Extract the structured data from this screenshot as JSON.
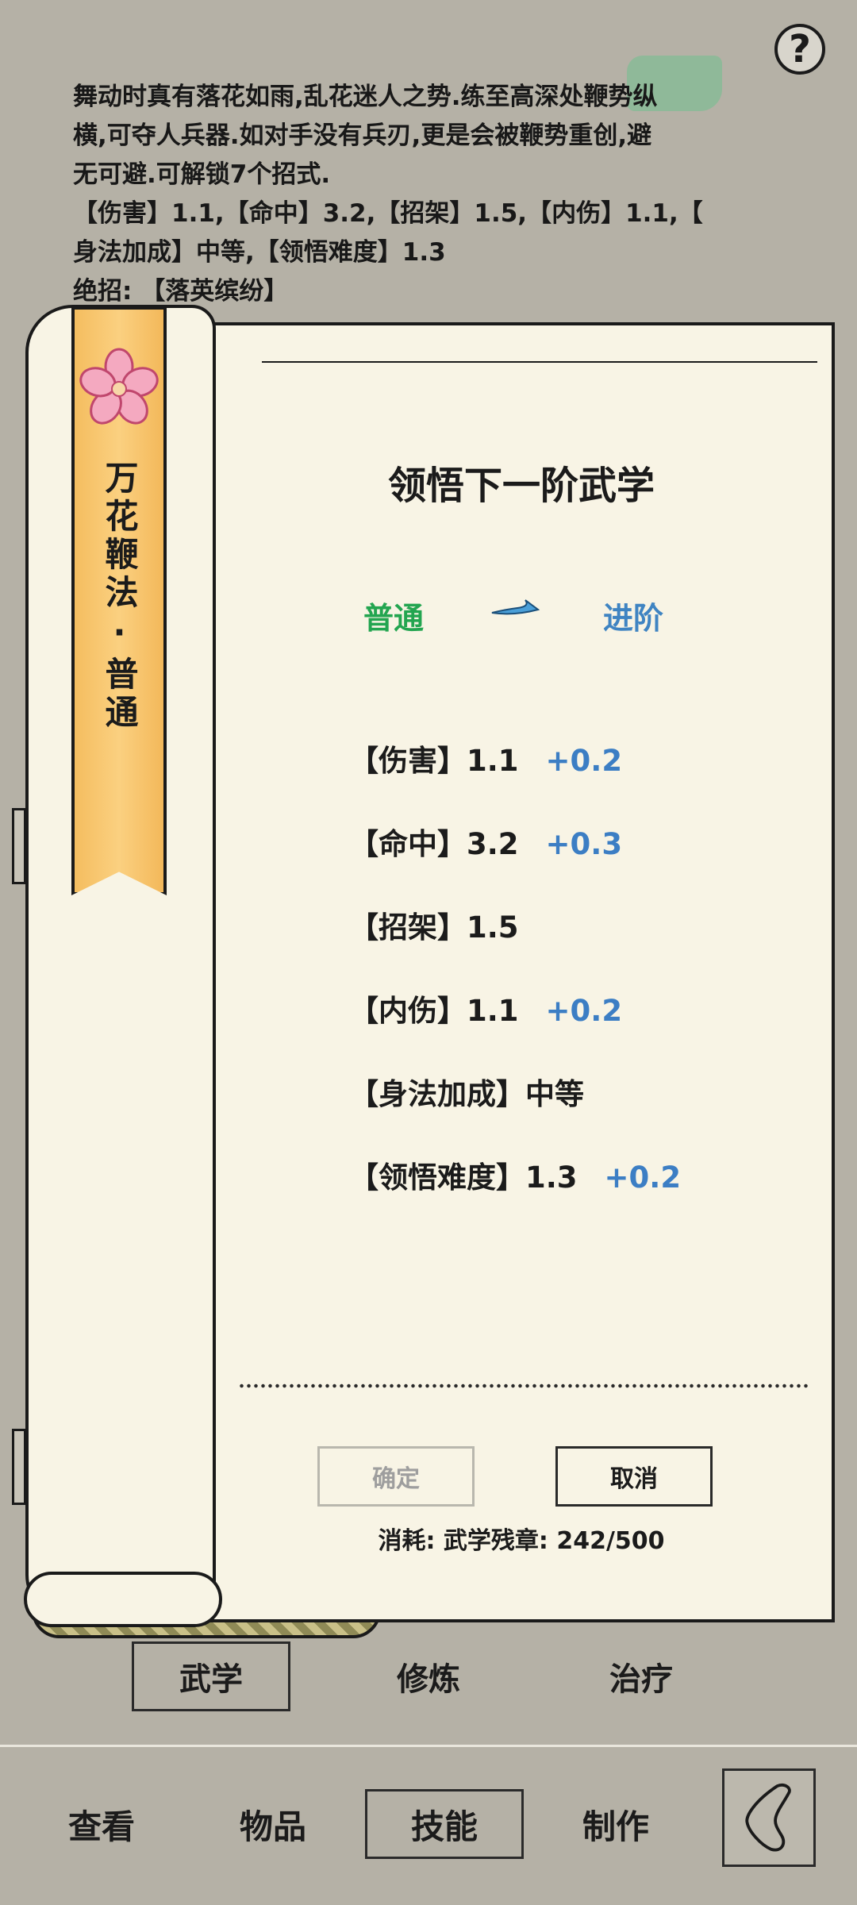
{
  "header": {
    "help_label": "?",
    "description": [
      "舞动时真有落花如雨,乱花迷人之势.练至高深处鞭势纵",
      "横,可夺人兵器.如对手没有兵刃,更是会被鞭势重创,避",
      "无可避.可解锁7个招式.",
      "【伤害】1.1,【命中】3.2,【招架】1.5,【内伤】1.1,【",
      "身法加成】中等,【领悟难度】1.3",
      "绝招: 【落英缤纷】"
    ]
  },
  "skill_banner": {
    "title": "万花鞭法·普通",
    "icon": "sakura-flower-icon"
  },
  "dialog": {
    "title": "领悟下一阶武学",
    "tier_from": "普通",
    "tier_to": "进阶",
    "stats": [
      {
        "label": "【伤害】1.1",
        "bonus": "+0.2"
      },
      {
        "label": "【命中】3.2",
        "bonus": "+0.3"
      },
      {
        "label": "【招架】1.5",
        "bonus": ""
      },
      {
        "label": "【内伤】1.1",
        "bonus": "+0.2"
      },
      {
        "label": "【身法加成】中等",
        "bonus": ""
      },
      {
        "label": "【领悟难度】1.3",
        "bonus": "+0.2"
      }
    ],
    "confirm_label": "确定",
    "cancel_label": "取消",
    "cost": "消耗: 武学残章: 242/500"
  },
  "sub_tabs": [
    "武学",
    "修炼",
    "治疗"
  ],
  "nav_tabs": [
    "查看",
    "物品",
    "技能",
    "制作"
  ],
  "colors": {
    "tier_from": "#23a550",
    "tier_to": "#3f84c2",
    "bonus": "#3c7ec4",
    "banner": "#fbd080"
  }
}
